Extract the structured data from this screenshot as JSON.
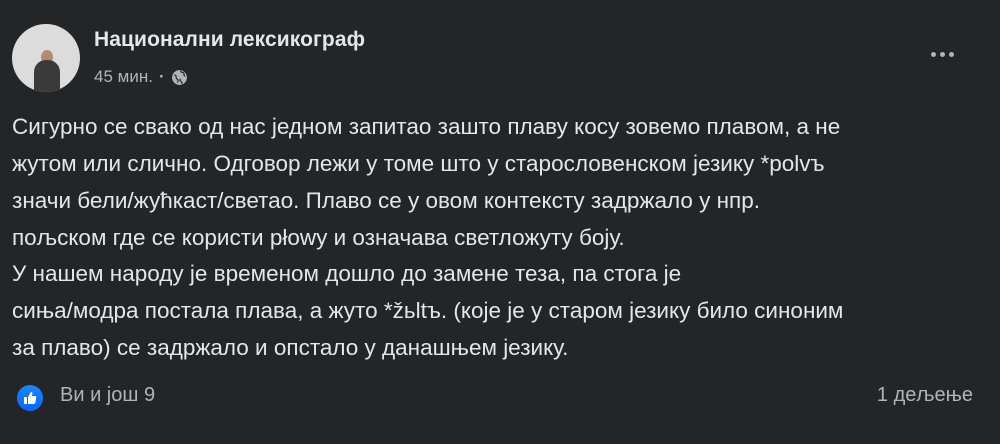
{
  "header": {
    "author": "Национални лексикограф",
    "time": "45 мин.",
    "separator": "·",
    "privacy_icon": "globe-icon",
    "more_icon": "more-options-icon"
  },
  "body": {
    "paragraph1_lines": [
      "Сигурно се свако од нас једном запитао зашто плаву косу зовемо плавом, а не",
      "жутом или слично. Одговор лежи у томе што у старословенском језику *polvъ",
      "значи бели/жућкаст/светао. Плаво се у овом контексту задржало у нпр.",
      "пољском где се користи płowy и означава светложуту боју."
    ],
    "paragraph2_lines": [
      "У нашем народу је временом дошло до замене теза, па стога је",
      "сиња/модра постала плава, а жуто *žьltъ. (које је у старом језику било синоним",
      "за плаво) се задржало и опстало у данашњем језику."
    ]
  },
  "footer": {
    "like_icon": "thumbs-up-icon",
    "likes": "Ви и још 9",
    "shares": "1 дељење"
  },
  "colors": {
    "background": "#242526",
    "primary_text": "#e4e6eb",
    "secondary_text": "#b0b3b8",
    "like_blue": "#0866ff"
  }
}
